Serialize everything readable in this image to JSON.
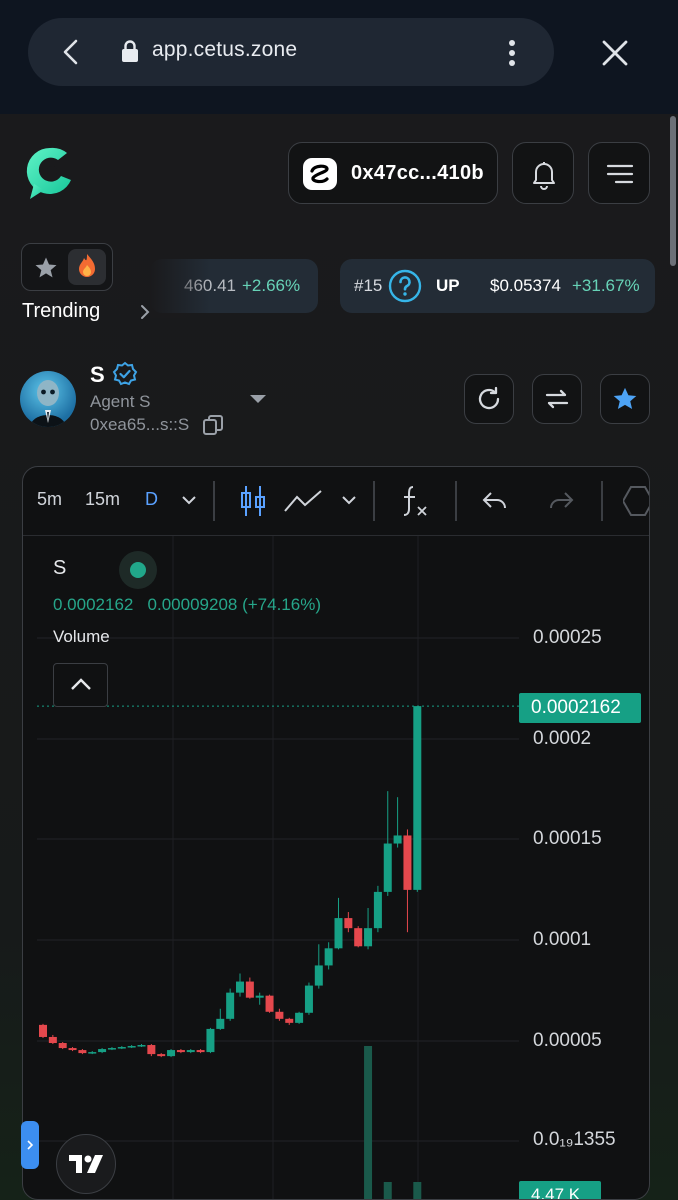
{
  "browser": {
    "url": "app.cetus.zone"
  },
  "header": {
    "wallet_address": "0x47cc...410b",
    "icons": [
      "cetus-logo-icon",
      "wallet-logo-icon",
      "bell-icon",
      "menu-icon"
    ]
  },
  "trending": {
    "label": "Trending",
    "ticker": [
      {
        "price": "460.41",
        "change": "+2.66%"
      },
      {
        "rank": "#15",
        "symbol": "UP",
        "price": "$0.05374",
        "change": "+31.67%"
      }
    ]
  },
  "token": {
    "symbol": "S",
    "name": "Agent S",
    "address": "0xea65...s::S"
  },
  "chart_toolbar": {
    "intervals": [
      "5m",
      "15m",
      "D"
    ],
    "active_interval": "D"
  },
  "chart_legend": {
    "symbol": "S",
    "price": "0.0002162",
    "change": "0.00009208 (+74.16%)",
    "volume_label": "Volume"
  },
  "colors": {
    "up": "#16a085",
    "down": "#e5484d",
    "accent": "#5aa1ff"
  },
  "chart_data": {
    "type": "candlestick",
    "y_ticks": [
      "0.00025",
      "0.0002",
      "0.00015",
      "0.0001",
      "0.00005",
      "0.0₁₉1355"
    ],
    "last_price_label": "0.0002162",
    "volume_label": "4.47 K",
    "ylim": [
      1.16e-05,
      0.00027
    ],
    "candles": [
      {
        "o": 5.8e-05,
        "c": 5.2e-05,
        "h": 5.85e-05,
        "l": 5.15e-05
      },
      {
        "o": 5.2e-05,
        "c": 4.9e-05,
        "h": 5.3e-05,
        "l": 4.85e-05
      },
      {
        "o": 4.9e-05,
        "c": 4.65e-05,
        "h": 4.95e-05,
        "l": 4.6e-05
      },
      {
        "o": 4.65e-05,
        "c": 4.55e-05,
        "h": 4.7e-05,
        "l": 4.5e-05
      },
      {
        "o": 4.55e-05,
        "c": 4.4e-05,
        "h": 4.6e-05,
        "l": 4.35e-05
      },
      {
        "o": 4.4e-05,
        "c": 4.45e-05,
        "h": 4.5e-05,
        "l": 4.35e-05
      },
      {
        "o": 4.45e-05,
        "c": 4.6e-05,
        "h": 4.65e-05,
        "l": 4.4e-05
      },
      {
        "o": 4.6e-05,
        "c": 4.65e-05,
        "h": 4.7e-05,
        "l": 4.55e-05
      },
      {
        "o": 4.65e-05,
        "c": 4.7e-05,
        "h": 4.75e-05,
        "l": 4.6e-05
      },
      {
        "o": 4.7e-05,
        "c": 4.75e-05,
        "h": 4.8e-05,
        "l": 4.65e-05
      },
      {
        "o": 4.75e-05,
        "c": 4.8e-05,
        "h": 4.85e-05,
        "l": 4.7e-05
      },
      {
        "o": 4.8e-05,
        "c": 4.35e-05,
        "h": 4.85e-05,
        "l": 4.25e-05
      },
      {
        "o": 4.35e-05,
        "c": 4.25e-05,
        "h": 4.4e-05,
        "l": 4.2e-05
      },
      {
        "o": 4.25e-05,
        "c": 4.55e-05,
        "h": 4.6e-05,
        "l": 4.2e-05
      },
      {
        "o": 4.55e-05,
        "c": 4.45e-05,
        "h": 4.6e-05,
        "l": 4.4e-05
      },
      {
        "o": 4.45e-05,
        "c": 4.55e-05,
        "h": 4.6e-05,
        "l": 4.4e-05
      },
      {
        "o": 4.55e-05,
        "c": 4.45e-05,
        "h": 4.6e-05,
        "l": 4.4e-05
      },
      {
        "o": 4.45e-05,
        "c": 5.6e-05,
        "h": 5.65e-05,
        "l": 4.4e-05
      },
      {
        "o": 5.6e-05,
        "c": 6.1e-05,
        "h": 6.6e-05,
        "l": 5.55e-05
      },
      {
        "o": 6.1e-05,
        "c": 7.4e-05,
        "h": 7.6e-05,
        "l": 6e-05
      },
      {
        "o": 7.4e-05,
        "c": 7.95e-05,
        "h": 8.35e-05,
        "l": 7.2e-05
      },
      {
        "o": 7.95e-05,
        "c": 7.15e-05,
        "h": 8.15e-05,
        "l": 7.1e-05
      },
      {
        "o": 7.15e-05,
        "c": 7.25e-05,
        "h": 7.4e-05,
        "l": 6.8e-05
      },
      {
        "o": 7.25e-05,
        "c": 6.45e-05,
        "h": 7.3e-05,
        "l": 6.4e-05
      },
      {
        "o": 6.45e-05,
        "c": 6.1e-05,
        "h": 6.6e-05,
        "l": 6e-05
      },
      {
        "o": 6.1e-05,
        "c": 5.9e-05,
        "h": 6.15e-05,
        "l": 5.8e-05
      },
      {
        "o": 5.9e-05,
        "c": 6.4e-05,
        "h": 6.45e-05,
        "l": 5.85e-05
      },
      {
        "o": 6.4e-05,
        "c": 7.75e-05,
        "h": 7.9e-05,
        "l": 6.3e-05
      },
      {
        "o": 7.75e-05,
        "c": 8.75e-05,
        "h": 9.8e-05,
        "l": 7.6e-05
      },
      {
        "o": 8.75e-05,
        "c": 9.6e-05,
        "h": 9.9e-05,
        "l": 8.55e-05
      },
      {
        "o": 9.6e-05,
        "c": 0.000111,
        "h": 0.000121,
        "l": 9.55e-05
      },
      {
        "o": 0.000111,
        "c": 0.000106,
        "h": 0.000114,
        "l": 0.000104
      },
      {
        "o": 0.000106,
        "c": 9.7e-05,
        "h": 0.000107,
        "l": 9.65e-05
      },
      {
        "o": 9.7e-05,
        "c": 0.000106,
        "h": 0.000116,
        "l": 9.55e-05
      },
      {
        "o": 0.000106,
        "c": 0.000124,
        "h": 0.000127,
        "l": 0.000104
      },
      {
        "o": 0.000124,
        "c": 0.000148,
        "h": 0.000174,
        "l": 0.000122
      },
      {
        "o": 0.000148,
        "c": 0.000152,
        "h": 0.000171,
        "l": 0.000146
      },
      {
        "o": 0.000152,
        "c": 0.000125,
        "h": 0.000155,
        "l": 0.000104
      },
      {
        "o": 0.000125,
        "c": 0.0002162,
        "h": 0.0002162,
        "l": 0.000124
      }
    ]
  }
}
